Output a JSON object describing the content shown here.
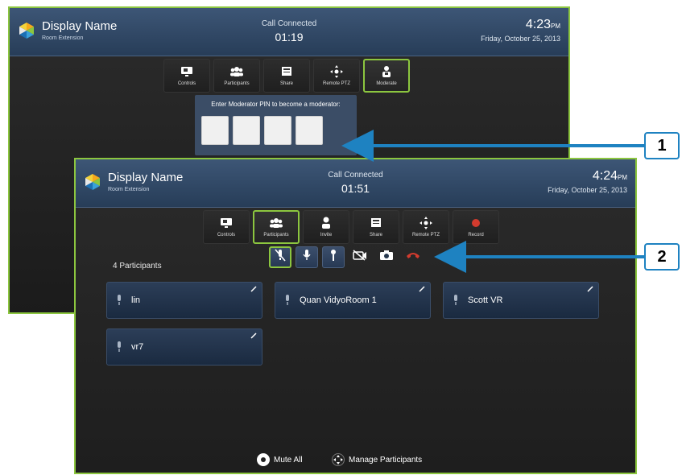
{
  "screen1": {
    "header": {
      "display_name": "Display Name",
      "subtitle": "Room Extension",
      "status": "Call Connected",
      "timer": "01:19",
      "time": "4:23",
      "ampm": "PM",
      "date": "Friday, October 25, 2013"
    },
    "toolbar": [
      {
        "label": "Controls",
        "icon": "monitor-icon"
      },
      {
        "label": "Participants",
        "icon": "participants-icon"
      },
      {
        "label": "Share",
        "icon": "share-icon"
      },
      {
        "label": "Remote PTZ",
        "icon": "ptz-icon"
      },
      {
        "label": "Moderate",
        "icon": "moderate-icon",
        "active": true
      }
    ],
    "pin_prompt": "Enter Moderator PIN to become a moderator:"
  },
  "screen2": {
    "header": {
      "display_name": "Display Name",
      "subtitle": "Room Extension",
      "status": "Call Connected",
      "timer": "01:51",
      "time": "4:24",
      "ampm": "PM",
      "date": "Friday, October 25, 2013"
    },
    "toolbar": [
      {
        "label": "Controls",
        "icon": "monitor-icon"
      },
      {
        "label": "Participants",
        "icon": "participants-icon",
        "active": true
      },
      {
        "label": "Invite",
        "icon": "invite-icon"
      },
      {
        "label": "Share",
        "icon": "share-icon"
      },
      {
        "label": "Remote PTZ",
        "icon": "ptz-icon"
      },
      {
        "label": "Record",
        "icon": "record-icon"
      }
    ],
    "participant_count": "4 Participants",
    "participant_controls": [
      "mute-speaker-icon",
      "microphone-icon",
      "microphone-alt-icon",
      "camera-off-icon",
      "camera-icon",
      "hang-up-icon"
    ],
    "participants": [
      {
        "name": "lin"
      },
      {
        "name": "Quan VidyoRoom 1"
      },
      {
        "name": "Scott VR"
      },
      {
        "name": "vr7"
      }
    ],
    "bottom": {
      "mute_all": "Mute All",
      "manage": "Manage Participants"
    }
  },
  "callouts": [
    "1",
    "2"
  ],
  "colors": {
    "active_border": "#8cc63f",
    "header_blue": "#2f4767",
    "callout_blue": "#1e82c1",
    "hangup_red": "#d23b2e"
  }
}
